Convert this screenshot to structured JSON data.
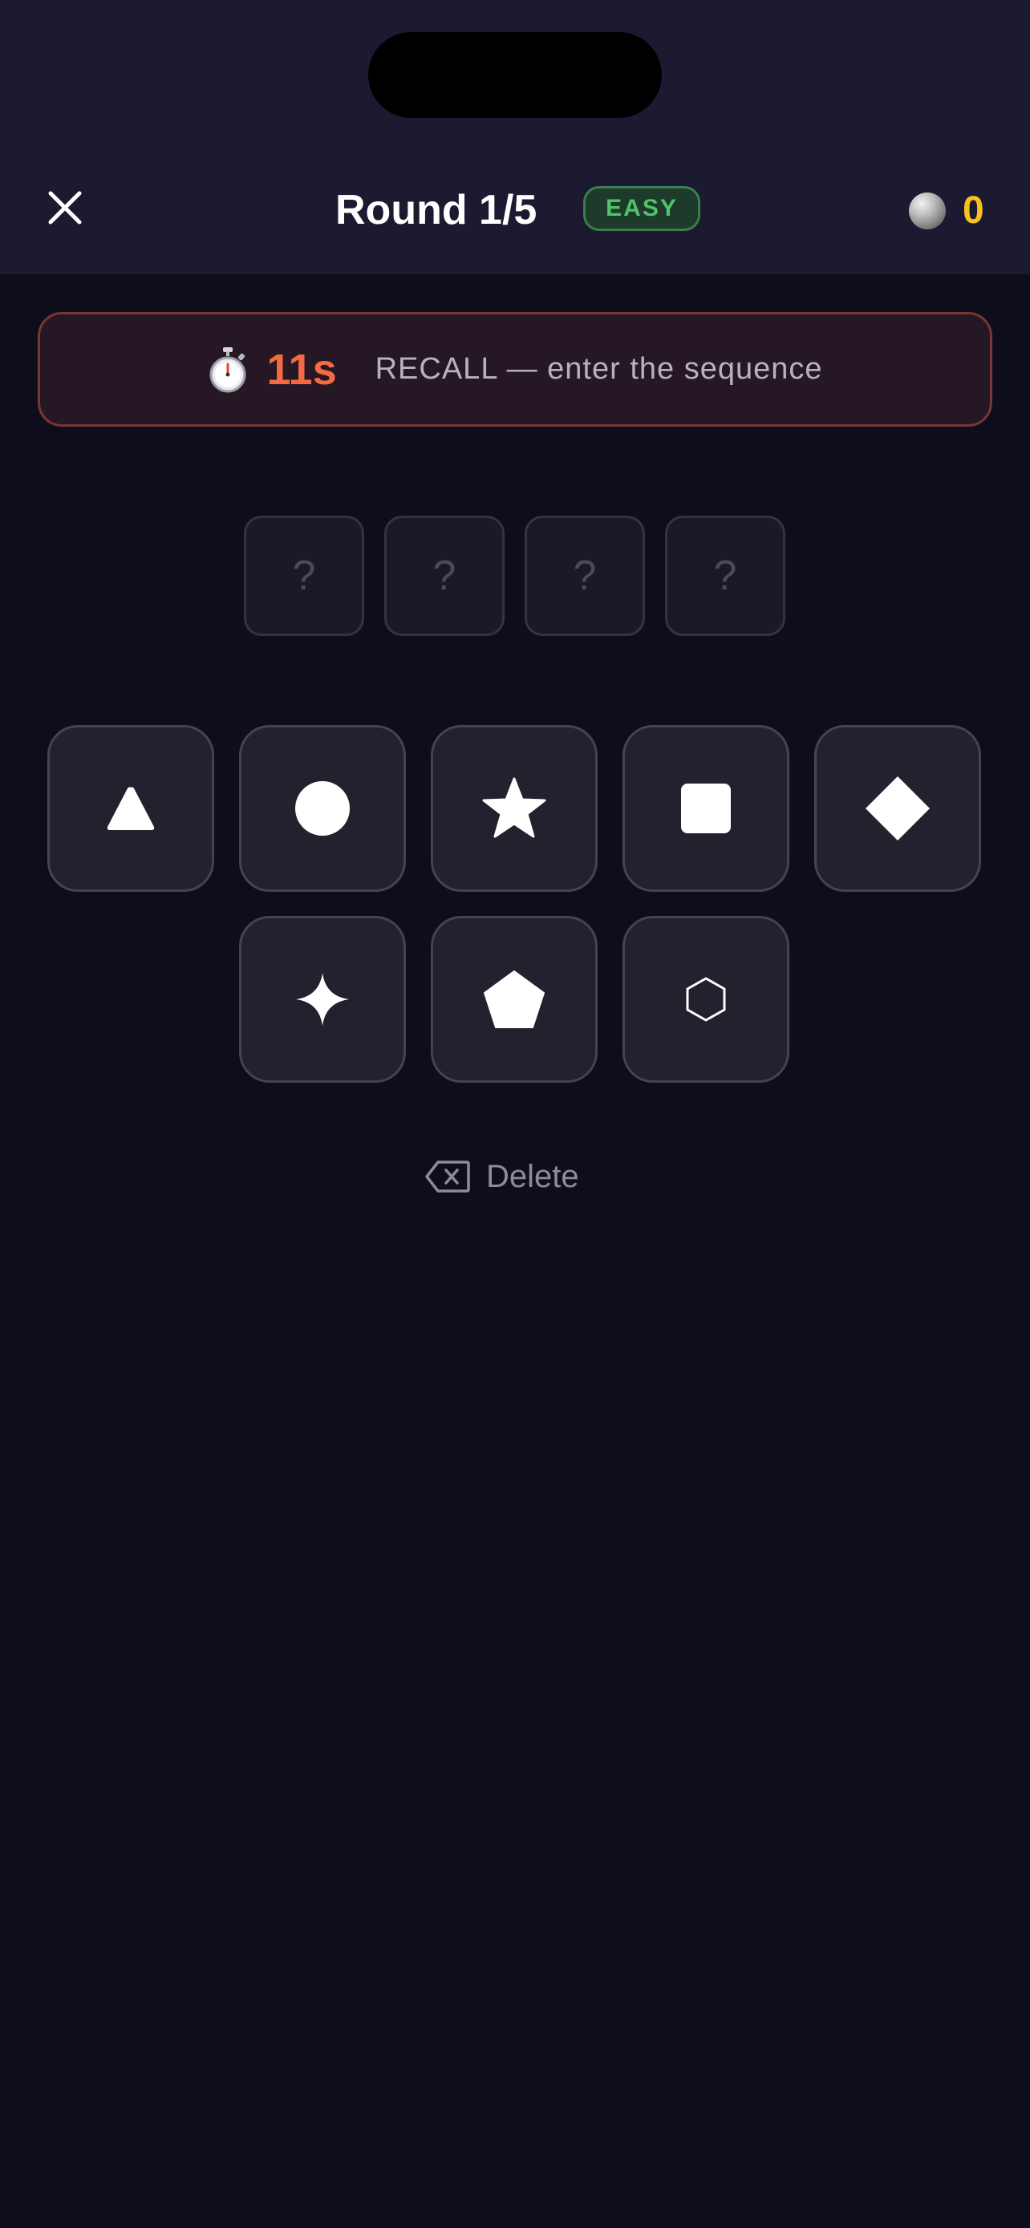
{
  "header": {
    "close_icon": "close-icon",
    "title": "Round 1/5",
    "difficulty": "EASY",
    "coin_icon": "coin-icon",
    "coin_count": "0"
  },
  "timer": {
    "icon": "stopwatch-icon",
    "seconds": "11s",
    "hint": "RECALL — enter the sequence",
    "accent_color": "#f46b43"
  },
  "sequence_slots": [
    "?",
    "?",
    "?",
    "?"
  ],
  "shape_buttons": [
    {
      "icon": "triangle-icon"
    },
    {
      "icon": "circle-icon"
    },
    {
      "icon": "star-icon"
    },
    {
      "icon": "square-icon"
    },
    {
      "icon": "diamond-icon"
    },
    {
      "icon": "sparkle-icon"
    },
    {
      "icon": "pentagon-icon"
    },
    {
      "icon": "hexagon-icon"
    }
  ],
  "delete": {
    "icon": "backspace-icon",
    "label": "Delete"
  },
  "colors": {
    "background": "#0e0d1c",
    "header_background": "#1b1a31",
    "badge_green": "#4fc46a",
    "coin_yellow": "#f6c31c"
  }
}
